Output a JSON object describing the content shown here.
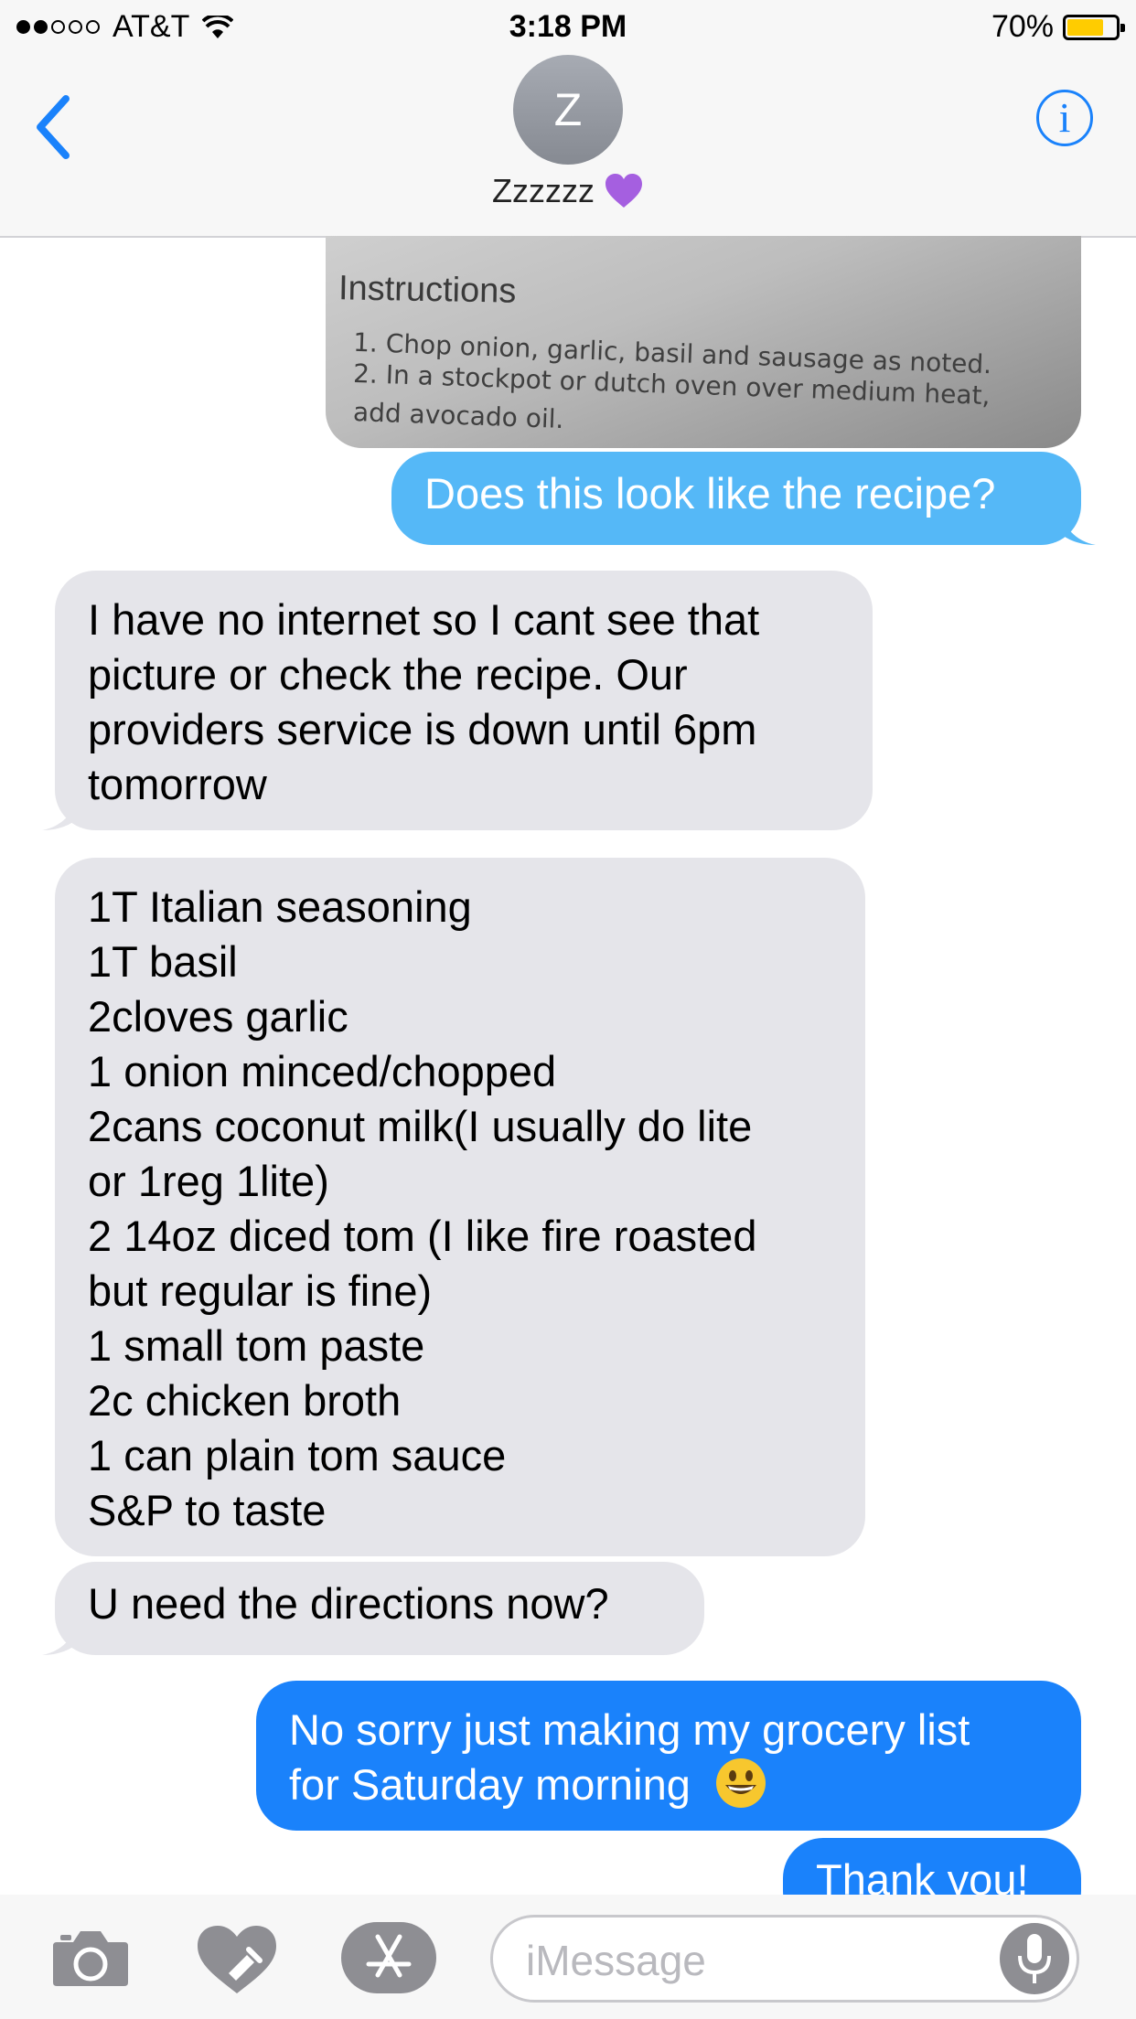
{
  "status_bar": {
    "carrier": "AT&T",
    "time": "3:18 PM",
    "battery": "70%",
    "battery_level": 0.7
  },
  "header": {
    "avatar_initial": "Z",
    "contact_name": "Zzzzzz",
    "contact_emoji": "purple-heart",
    "back_icon": "chevron-left-icon",
    "info_icon": "info-icon",
    "info_glyph": "i"
  },
  "photo": {
    "title": "Instructions",
    "lines": [
      "1. Chop onion, garlic, basil and sausage as noted.",
      "2. In a stockpot or dutch oven over medium heat,",
      "   add avocado oil."
    ]
  },
  "messages": [
    {
      "sender": "me",
      "lines": [
        "Does this look like the recipe?"
      ]
    },
    {
      "sender": "them",
      "lines": [
        "I have no internet so I cant see that",
        "picture or check the recipe. Our",
        "providers service is down until 6pm",
        "tomorrow"
      ]
    },
    {
      "sender": "them",
      "lines": [
        "1T Italian seasoning",
        "1T basil",
        "2cloves garlic",
        "1 onion minced/chopped",
        "2cans coconut milk(I usually do lite",
        "or 1reg 1lite)",
        "2 14oz diced tom (I like fire roasted",
        "but regular is fine)",
        "1 small tom paste",
        "2c chicken broth",
        "1 can plain tom sauce",
        "S&P to taste"
      ]
    },
    {
      "sender": "them",
      "lines": [
        "U need the directions now?"
      ]
    },
    {
      "sender": "me",
      "lines": [
        "No sorry just making my grocery list",
        "for Saturday morning"
      ],
      "emoji": "grinning-face"
    },
    {
      "sender": "me",
      "lines": [
        "Thank you!"
      ]
    }
  ],
  "input_bar": {
    "placeholder": "iMessage",
    "icons": [
      "camera-icon",
      "digital-touch-icon",
      "app-store-icon",
      "microphone-icon"
    ]
  },
  "colors": {
    "accent": "#1a82fb",
    "sent_bubble": "#1a82fb",
    "received_bubble": "#e5e5ea",
    "battery": "#ffcc00"
  }
}
